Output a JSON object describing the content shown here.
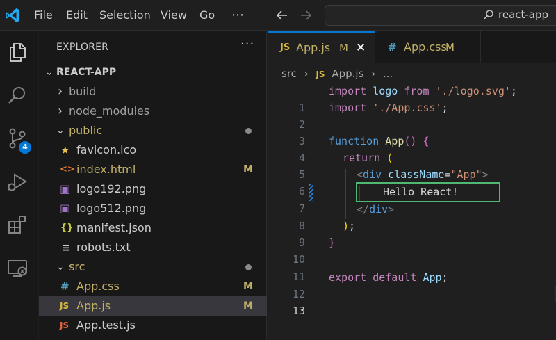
{
  "menu": [
    "File",
    "Edit",
    "Selection",
    "View",
    "Go",
    "⋯"
  ],
  "search": {
    "text": "react-app"
  },
  "activity": {
    "scm_badge": "4"
  },
  "explorer": {
    "title": "EXPLORER",
    "more": "···",
    "root": "REACT-APP",
    "items": [
      {
        "label": "build",
        "kind": "folder-closed",
        "glyph": "›"
      },
      {
        "label": "node_modules",
        "kind": "folder-closed",
        "glyph": "›"
      },
      {
        "label": "public",
        "kind": "folder-open",
        "glyph": "⌄"
      },
      {
        "label": "favicon.ico",
        "icon": "★"
      },
      {
        "label": "index.html",
        "icon": "<>",
        "status": "M"
      },
      {
        "label": "logo192.png",
        "icon": "▣"
      },
      {
        "label": "logo512.png",
        "icon": "▣"
      },
      {
        "label": "manifest.json",
        "icon": "{}"
      },
      {
        "label": "robots.txt",
        "icon": "≡"
      },
      {
        "label": "src",
        "kind": "folder-open",
        "glyph": "⌄"
      },
      {
        "label": "App.css",
        "icon": "#",
        "status": "M"
      },
      {
        "label": "App.js",
        "icon": "JS",
        "status": "M"
      },
      {
        "label": "App.test.js",
        "icon": "JS"
      }
    ]
  },
  "tabs": [
    {
      "icon": "JS",
      "label": "App.js",
      "status": "M",
      "close": "✕"
    },
    {
      "icon": "#",
      "label": "App.css",
      "status": "M"
    }
  ],
  "breadcrumb": {
    "folder": "src",
    "sep1": "›",
    "icon": "JS",
    "file": "App.js",
    "sep2": "›",
    "more": "..."
  },
  "code": {
    "line_numbers": [
      "1",
      "2",
      "3",
      "4",
      "5",
      "6",
      "7",
      "8",
      "9",
      "10",
      "11",
      "12",
      "13"
    ],
    "l1": {
      "kw": "import",
      "name": " logo ",
      "from": "from",
      "str": " './logo.svg'",
      "end": ";"
    },
    "l2": {
      "kw": "import",
      "str": " './App.css'",
      "end": ";"
    },
    "l4": {
      "kw": "function",
      "fn": " App",
      "paren": "()",
      "brace": " {"
    },
    "l5": {
      "kw": "return",
      "paren": " ("
    },
    "l6": {
      "open": "<",
      "tag": "div",
      "attr": " className",
      "eq": "=",
      "val": "\"App\"",
      "close": ">"
    },
    "l7": {
      "text": "Hello React!"
    },
    "l8": {
      "open": "</",
      "tag": "div",
      "close": ">"
    },
    "l9": {
      "paren": ")",
      "semi": ";"
    },
    "l10": {
      "brace": "}"
    },
    "l12": {
      "kw1": "export",
      "kw2": " default",
      "name": " App",
      "end": ";"
    }
  },
  "colors": {
    "accent": "#0078d4",
    "modified": "#c2b068",
    "highlight_box": "#4fb873"
  }
}
